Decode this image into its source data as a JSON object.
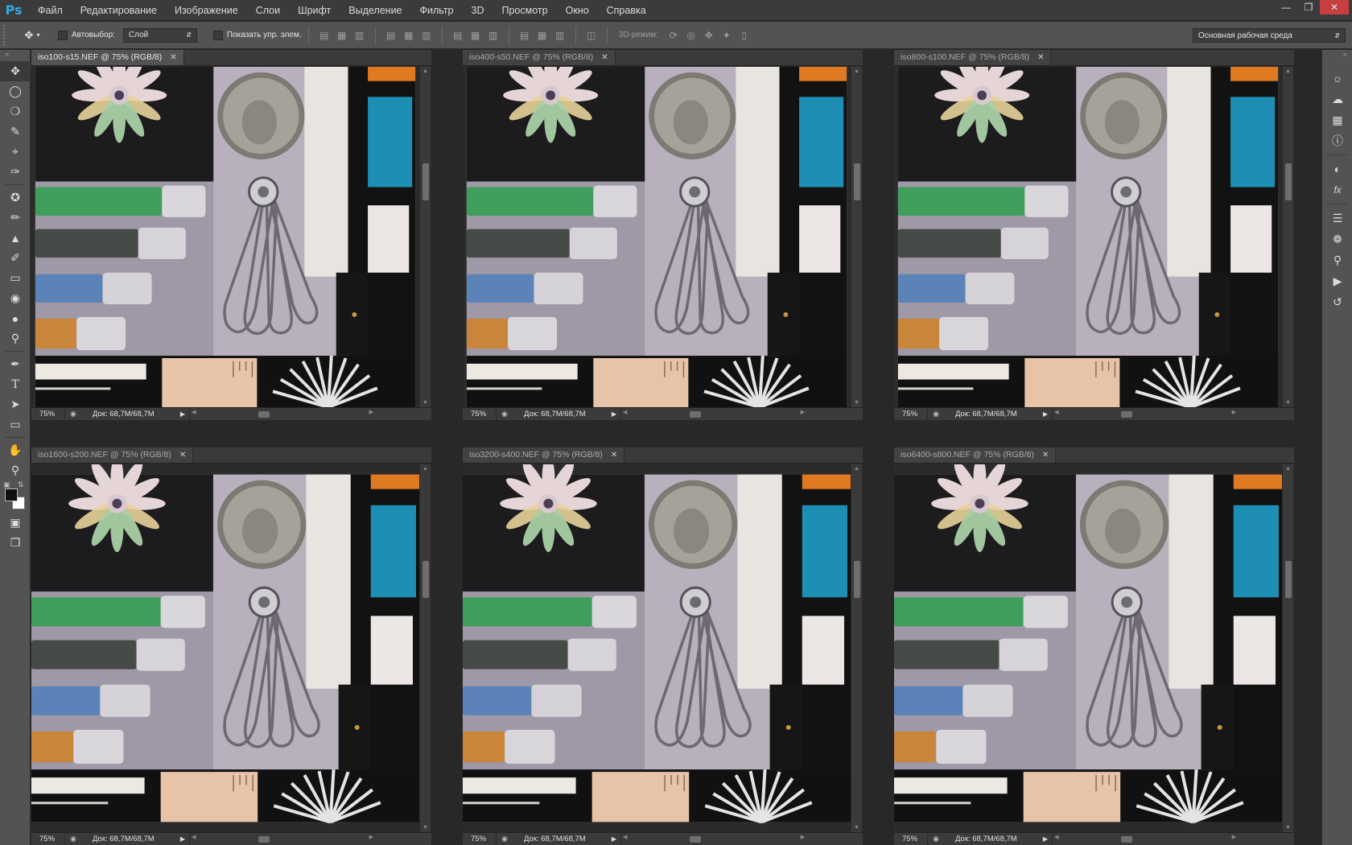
{
  "app": {
    "logo": "Ps",
    "menu": [
      "Файл",
      "Редактирование",
      "Изображение",
      "Слои",
      "Шрифт",
      "Выделение",
      "Фильтр",
      "3D",
      "Просмотр",
      "Окно",
      "Справка"
    ]
  },
  "options_bar": {
    "autoselect_label": "Автовыбор:",
    "autoselect_value": "Слой",
    "show_transform_label": "Показать упр. элем.",
    "mode_3d_label": "3D-режим:",
    "workspace_value": "Основная рабочая среда"
  },
  "documents": [
    {
      "tab": "iso100-s15.NEF @ 75% (RGB/8)",
      "zoom": "75%",
      "doc_info": "Док: 68,7M/68,7M",
      "active": true
    },
    {
      "tab": "iso400-s50.NEF @ 75% (RGB/8)",
      "zoom": "75%",
      "doc_info": "Док: 68,7M/68,7M",
      "active": false
    },
    {
      "tab": "iso800-s100.NEF @ 75% (RGB/8)",
      "zoom": "75%",
      "doc_info": "Док: 68,7M/68,7M",
      "active": false
    },
    {
      "tab": "iso1600-s200.NEF @ 75% (RGB/8)",
      "zoom": "75%",
      "doc_info": "Док: 68,7M/68,7M",
      "active": false
    },
    {
      "tab": "iso3200-s400.NEF @ 75% (RGB/8)",
      "zoom": "75%",
      "doc_info": "Док: 68,7M/68,7M",
      "active": false
    },
    {
      "tab": "iso6400-s800.NEF @ 75% (RGB/8)",
      "zoom": "75%",
      "doc_info": "Док: 68,7M/68,7M",
      "active": false
    }
  ],
  "colors": {
    "foreground": "#101010",
    "background": "#ffffff",
    "accent_blue": "#1e8fb4",
    "accent_orange": "#e07a22"
  },
  "tools": [
    "move-icon",
    "marquee-icon",
    "lasso-icon",
    "quick-select-icon",
    "crop-icon",
    "eyedropper-icon",
    "spot-heal-icon",
    "brush-icon",
    "clone-stamp-icon",
    "history-brush-icon",
    "eraser-icon",
    "paint-bucket-icon",
    "blur-icon",
    "dodge-icon",
    "pen-icon",
    "type-icon",
    "path-select-icon",
    "rectangle-icon",
    "hand-icon",
    "zoom-icon"
  ],
  "dock_panels": [
    "adjust-icon",
    "brush-preset-icon",
    "swatches-icon",
    "info-icon",
    "color-icon",
    "styles-icon",
    "layers-icon",
    "channels-icon",
    "paths-icon",
    "actions-icon",
    "history-icon"
  ]
}
